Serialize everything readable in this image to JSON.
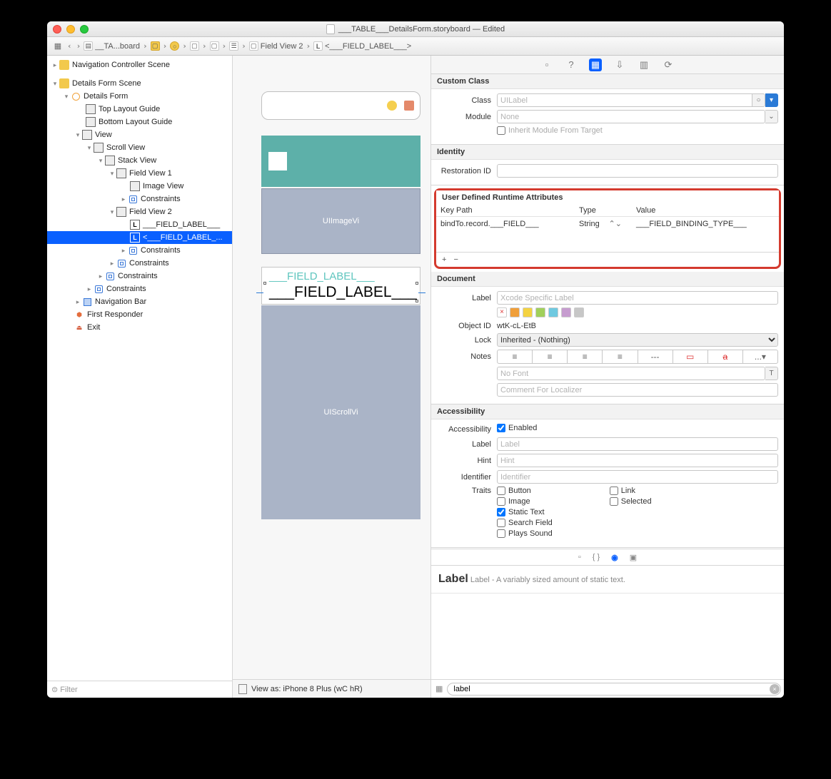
{
  "title": "___TABLE___DetailsForm.storyboard — Edited",
  "breadcrumb": {
    "file": "__TA...board",
    "fv2": "Field View 2",
    "fl": "<___FIELD_LABEL___>"
  },
  "tree": {
    "nav_scene": "Navigation Controller Scene",
    "details_scene": "Details Form Scene",
    "details_form": "Details Form",
    "top_guide": "Top Layout Guide",
    "bot_guide": "Bottom Layout Guide",
    "view": "View",
    "scroll": "Scroll View",
    "stack": "Stack View",
    "fv1": "Field View 1",
    "imgv": "Image View",
    "constraints": "Constraints",
    "fv2": "Field View 2",
    "fl1": "___FIELD_LABEL___",
    "fl2": "<___FIELD_LABEL_...",
    "navbar": "Navigation Bar",
    "first_responder": "First Responder",
    "exit": "Exit"
  },
  "filter_placeholder": "Filter",
  "canvas": {
    "imgview": "UIImageVi",
    "fl1": "___FIELD_LABEL___",
    "fl2": "___FIELD_LABEL___",
    "scroll": "UIScrollVi",
    "viewas": "View as: iPhone 8 Plus (wC hR)"
  },
  "inspector": {
    "custom_class": {
      "heading": "Custom Class",
      "class_k": "Class",
      "class_ph": "UILabel",
      "module_k": "Module",
      "module_ph": "None",
      "inherit": "Inherit Module From Target"
    },
    "identity": {
      "heading": "Identity",
      "rest_k": "Restoration ID"
    },
    "runtime": {
      "heading": "User Defined Runtime Attributes",
      "col1": "Key Path",
      "col2": "Type",
      "col3": "Value",
      "keypath": "bindTo.record.___FIELD___",
      "type": "String",
      "value": "___FIELD_BINDING_TYPE___"
    },
    "doc": {
      "heading": "Document",
      "label_k": "Label",
      "label_ph": "Xcode Specific Label",
      "objid_k": "Object ID",
      "objid_v": "wtK-cL-EtB",
      "lock_k": "Lock",
      "lock_v": "Inherited - (Nothing)",
      "notes_k": "Notes",
      "nofont": "No Font",
      "comment_ph": "Comment For Localizer"
    },
    "acc": {
      "heading": "Accessibility",
      "acc_k": "Accessibility",
      "enabled": "Enabled",
      "label_k": "Label",
      "label_ph": "Label",
      "hint_k": "Hint",
      "hint_ph": "Hint",
      "id_k": "Identifier",
      "id_ph": "Identifier",
      "traits_k": "Traits",
      "t_button": "Button",
      "t_link": "Link",
      "t_image": "Image",
      "t_selected": "Selected",
      "t_static": "Static Text",
      "t_search": "Search Field",
      "t_sound": "Plays Sound"
    },
    "library": {
      "title": "Label",
      "desc": "Label - A variably sized amount of static text.",
      "search": "label"
    }
  }
}
